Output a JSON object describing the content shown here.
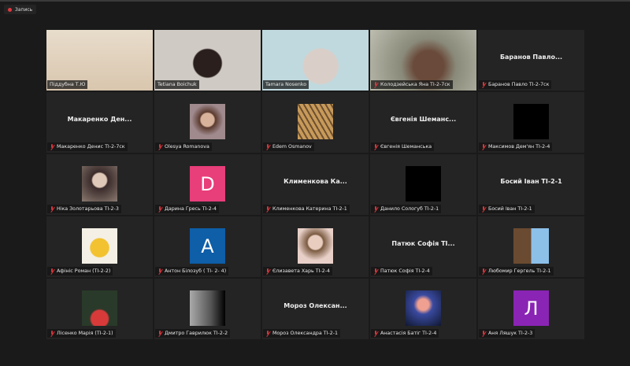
{
  "recording": {
    "label": "Запись",
    "color": "#e0383e"
  },
  "accent_active": "#c7e35a",
  "tiles": [
    {
      "type": "video",
      "label": "Піддубна Т.Ю",
      "active": true,
      "muted": false,
      "bg": "linear-gradient(180deg,#e8dccb,#d9c6ae)"
    },
    {
      "type": "video",
      "label": "Tetiana Boichuk",
      "muted": false,
      "bg": "radial-gradient(circle at 50% 55%,#2a1f1c 0 22%,#cfcac4 24%)"
    },
    {
      "type": "video",
      "label": "Tamara Nosenko",
      "muted": false,
      "bg": "radial-gradient(circle at 55% 60%,#d9cfc8 0 25%,#bfd9df 27%)"
    },
    {
      "type": "video",
      "label": "Колодзейська Яна ТІ-2-7ск",
      "muted": true,
      "bg": "radial-gradient(circle at 55% 60%,#6a4a3a 0 22%,#8a8a7a 40%,#bdbdb0)"
    },
    {
      "type": "name",
      "display": "Баранов  Павло...",
      "label": "Баранов Павло ТІ-2-7ск",
      "muted": true
    },
    {
      "type": "name",
      "display": "Макаренко  Ден...",
      "label": "Макаренко Денис ТІ-2-7ск",
      "muted": true
    },
    {
      "type": "avatar",
      "label": "Olesya Romanova",
      "muted": true,
      "bg": "radial-gradient(circle at 50% 45%,#d8b29a 0 25%,#5a3a2e 30%,#a08a8e 60%)"
    },
    {
      "type": "avatar",
      "label": "Edem Osmanov",
      "muted": true,
      "bg": "repeating-linear-gradient(60deg,#c79a5a 0 4px,#6e5030 4px 6px)"
    },
    {
      "type": "name",
      "display": "Євгенія  Шеманс...",
      "label": "Євгенія Шеманська",
      "muted": true
    },
    {
      "type": "avatar",
      "label": "Максимов Дем'ян ТІ-2-4",
      "muted": true,
      "bg": "#000000"
    },
    {
      "type": "avatar",
      "label": "Ніка Золотарьова ТІ-2-3",
      "muted": true,
      "bg": "radial-gradient(circle at 50% 40%,#e0c8b8 0 25%,#3a2a2a 30%,#8a7a70)"
    },
    {
      "type": "letter",
      "letter": "D",
      "label": "Дарина Гресь ТІ-2-4",
      "muted": true,
      "bg": "#e83e7a"
    },
    {
      "type": "name",
      "display": "Клименкова  Ка...",
      "label": "Клименкова Катерина ТІ-2-1",
      "muted": true
    },
    {
      "type": "avatar",
      "label": "Данило Сологуб ТІ-2-1",
      "muted": true,
      "bg": "#000000"
    },
    {
      "type": "name",
      "display": "Босий Іван ТІ-2-1",
      "label": "Босий Іван ТІ-2-1",
      "muted": true
    },
    {
      "type": "avatar",
      "label": "Афініс Роман (ТІ-2-2)",
      "muted": true,
      "bg": "radial-gradient(circle at 50% 55%,#f2c230 0 35%,#f4f0e6 38%)"
    },
    {
      "type": "letter",
      "letter": "A",
      "label": "Антон Білозуб ( ТІ- 2- 4)",
      "muted": true,
      "bg": "#0e5ea8"
    },
    {
      "type": "avatar",
      "label": "Єлизавета Харь  ТІ-2-4",
      "muted": true,
      "bg": "radial-gradient(circle at 50% 40%,#e9cdbf 0 25%,#7a5a40 30%,#e8d0c8 65%)"
    },
    {
      "type": "name",
      "display": "Патюк  Софія  ТІ...",
      "label": "Патюк Софія  ТІ-2-4",
      "muted": true
    },
    {
      "type": "avatar",
      "label": "Любомир Гергель ТІ-2-1",
      "muted": true,
      "bg": "linear-gradient(90deg,#6a4a30 0 50%,#8cc0e8 50%)"
    },
    {
      "type": "avatar",
      "label": "Лісенко Марія (ТІ-2-1)",
      "muted": true,
      "bg": "radial-gradient(circle at 50% 80%,#d83a3a 0 25%,#2a3a2a 30%)"
    },
    {
      "type": "avatar",
      "label": "Дмитро Гаврилюк ТІ-2-2",
      "muted": true,
      "bg": "linear-gradient(90deg,#aaaaaa,#555 60%,#000)"
    },
    {
      "type": "name",
      "display": "Мороз  Олексан...",
      "label": "Мороз Олександра ТІ-2-1",
      "muted": true
    },
    {
      "type": "avatar",
      "label": "Анастасія Батіг  ТІ-2-4",
      "muted": true,
      "bg": "radial-gradient(circle at 50% 40%,#f0a090 0 20%,#3a4aa0 35%,#101830)"
    },
    {
      "type": "letter",
      "letter": "Л",
      "label": "Аня Ляшук ТІ-2-3",
      "muted": true,
      "bg": "#8a24b4"
    }
  ]
}
